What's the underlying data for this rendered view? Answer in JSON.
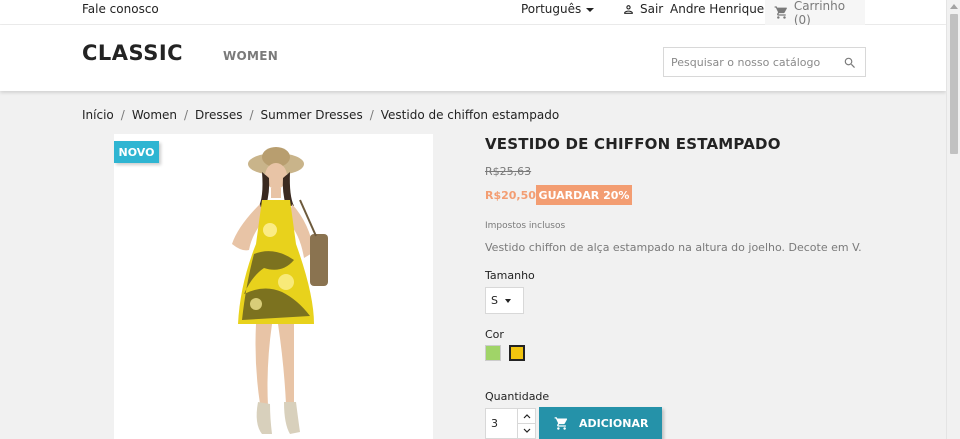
{
  "topbar": {
    "contact": "Fale conosco",
    "language": "Português",
    "signout": "Sair",
    "username": "Andre Henrique",
    "cart": "Carrinho (0)"
  },
  "header": {
    "logo": "CLASSIC",
    "menu": [
      "WOMEN"
    ],
    "search_placeholder": "Pesquisar o nosso catálogo"
  },
  "breadcrumb": [
    "Início",
    "Women",
    "Dresses",
    "Summer Dresses",
    "Vestido de chiffon estampado"
  ],
  "product": {
    "badge": "NOVO",
    "title": "VESTIDO DE CHIFFON ESTAMPADO",
    "regular_price": "R$25,63",
    "price": "R$20,50",
    "discount": "GUARDAR 20%",
    "tax_note": "Impostos inclusos",
    "description": "Vestido chiffon de alça estampado na altura do joelho. Decote em V.",
    "size_label": "Tamanho",
    "size_value": "S",
    "color_label": "Cor",
    "colors": [
      "#a0d468",
      "#f1c40f"
    ],
    "quantity_label": "Quantidade",
    "quantity_value": "3",
    "add_button": "ADICIONAR"
  },
  "colors": {
    "accent": "#2fb5d2",
    "add_button": "#2592a9",
    "discount": "#f39d72"
  },
  "icons": {
    "caret": "caret-down-icon",
    "user": "user-icon",
    "cart": "cart-icon",
    "search": "search-icon"
  }
}
